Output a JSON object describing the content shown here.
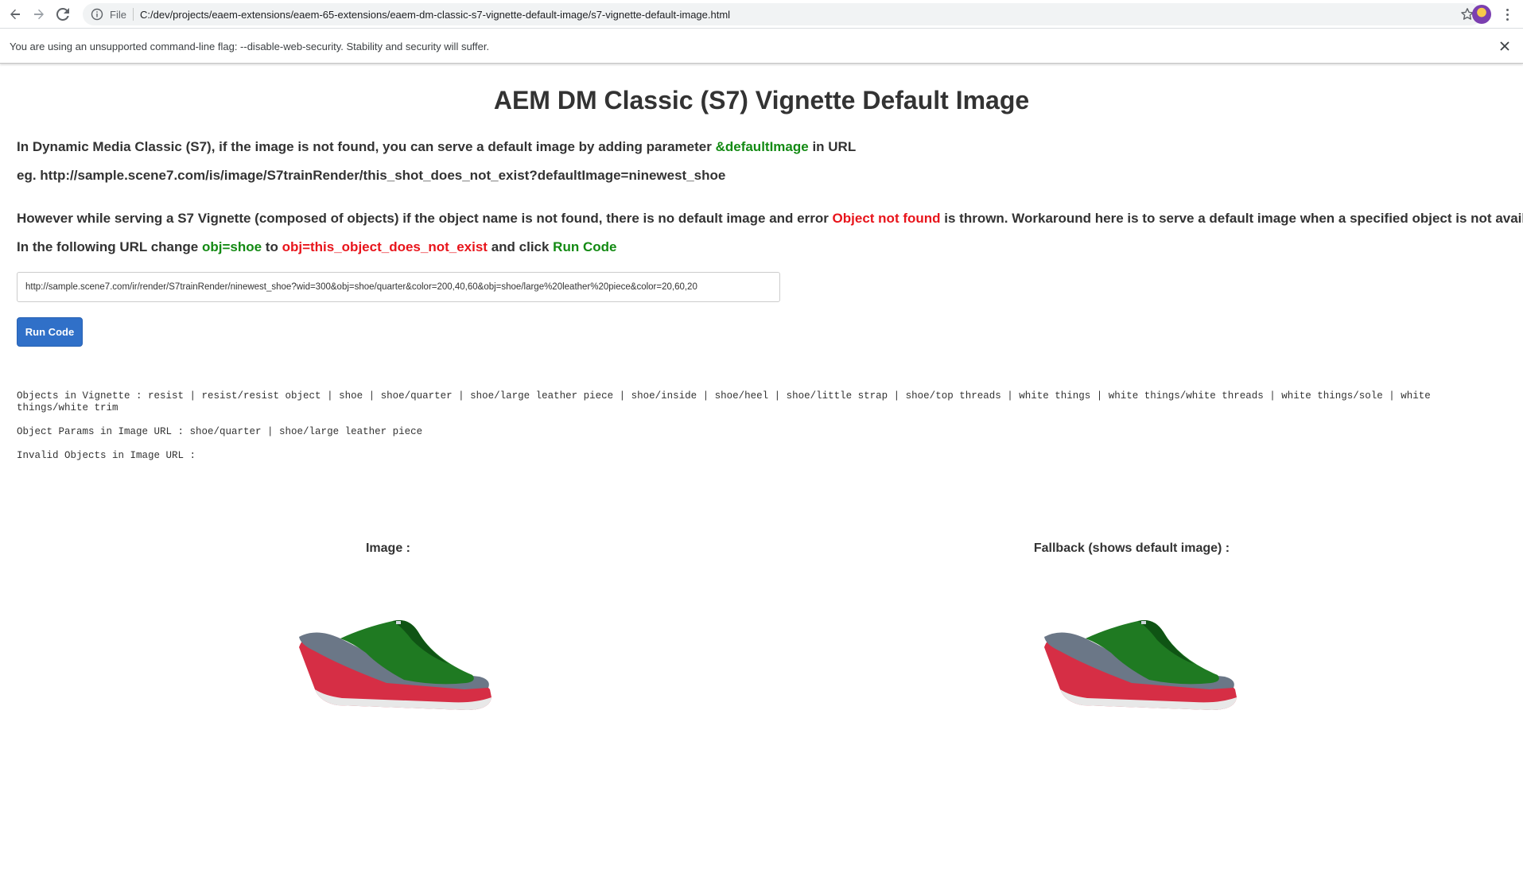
{
  "browser": {
    "scheme_label": "File",
    "url": "C:/dev/projects/eaem-extensions/eaem-65-extensions/eaem-dm-classic-s7-vignette-default-image/s7-vignette-default-image.html"
  },
  "infobar": {
    "message": "You are using an unsupported command-line flag: --disable-web-security. Stability and security will suffer."
  },
  "page": {
    "title": "AEM DM Classic (S7) Vignette Default Image",
    "intro": {
      "before": "In Dynamic Media Classic (S7), if the image is not found, you can serve a default image by adding parameter ",
      "param": "&defaultImage",
      "after": " in URL"
    },
    "example": "eg. http://sample.scene7.com/is/image/S7trainRender/this_shot_does_not_exist?defaultImage=ninewest_shoe",
    "vignette_note": {
      "before": "However while serving a S7 Vignette (composed of objects) if the object name is not found, there is no default image and error ",
      "error": "Object not found",
      "after": " is thrown. Workaround here is to serve a default image when a specified object is not available..."
    },
    "instruction": {
      "part1": "In the following URL change ",
      "obj_from": "obj=shoe",
      "part2": " to ",
      "obj_to": "obj=this_object_does_not_exist",
      "part3": " and click ",
      "run_code": "Run Code"
    },
    "url_input_value": "http://sample.scene7.com/ir/render/S7trainRender/ninewest_shoe?wid=300&obj=shoe/quarter&color=200,40,60&obj=shoe/large%20leather%20piece&color=20,60,20",
    "run_button_label": "Run Code",
    "objects_line1": "Objects in Vignette : resist | resist/resist object | shoe | shoe/quarter | shoe/large leather piece | shoe/inside | shoe/heel | shoe/little strap | shoe/top threads | white things | white things/white threads | white things/sole | white",
    "objects_line2": "things/white trim",
    "object_params": "Object Params in Image URL : shoe/quarter | shoe/large leather piece",
    "invalid_objects": "Invalid Objects in Image URL :",
    "image_label": "Image :",
    "fallback_label": "Fallback (shows default image) :"
  },
  "colors": {
    "green": "#138a13",
    "red": "#e8141b",
    "button": "#3070c8",
    "shoe_upper": "#1f7a22",
    "shoe_sole": "#d62e45"
  }
}
